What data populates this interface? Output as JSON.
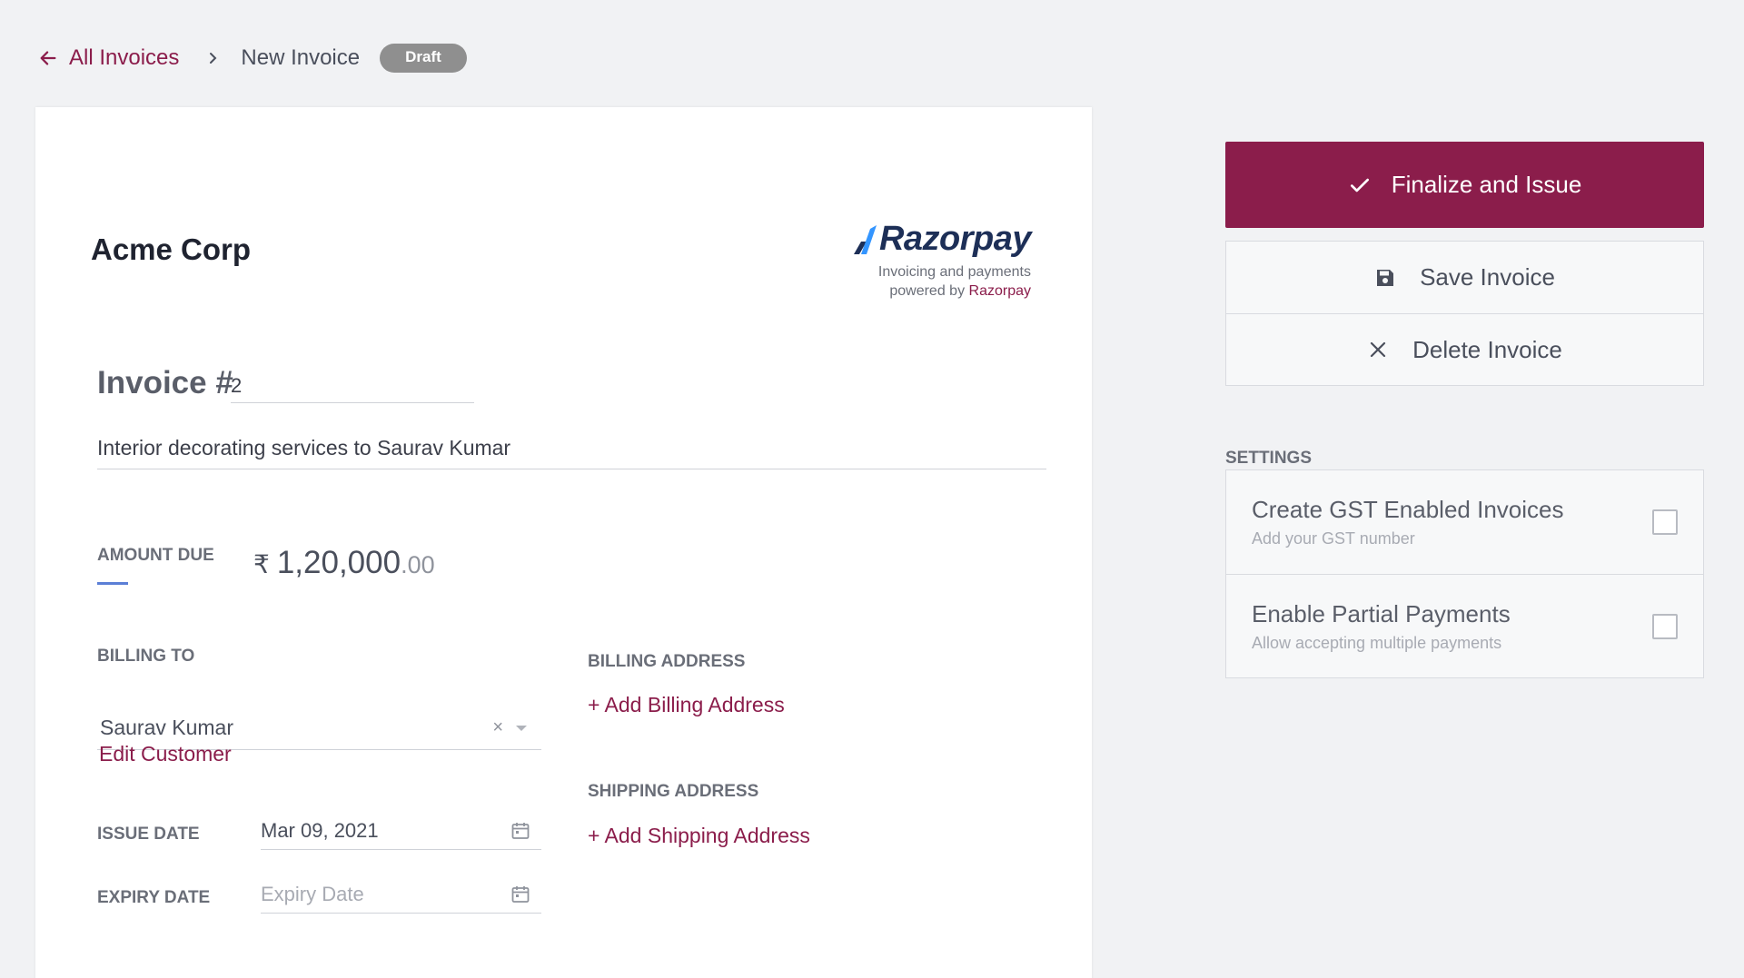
{
  "breadcrumb": {
    "back_label": "All Invoices",
    "current": "New Invoice",
    "status": "Draft"
  },
  "invoice": {
    "company": "Acme Corp",
    "brand": {
      "name": "Razorpay",
      "tagline_line1": "Invoicing and payments",
      "tagline_prefix": "powered by",
      "tagline_brand": "Razorpay"
    },
    "number_label": "Invoice #",
    "number": "2",
    "description": "Interior decorating services to Saurav Kumar",
    "amount_label": "AMOUNT DUE",
    "currency_symbol": "₹",
    "amount_int": "1,20,000",
    "amount_dec": ".00",
    "billing_to_label": "BILLING TO",
    "customer": "Saurav Kumar",
    "clear_glyph": "×",
    "edit_customer": "Edit Customer",
    "issue_date_label": "ISSUE DATE",
    "issue_date": "Mar 09, 2021",
    "expiry_date_label": "EXPIRY DATE",
    "expiry_date_placeholder": "Expiry Date",
    "billing_address_label": "BILLING ADDRESS",
    "add_billing_address": "+ Add Billing Address",
    "shipping_address_label": "SHIPPING ADDRESS",
    "add_shipping_address": "+ Add Shipping Address"
  },
  "actions": {
    "finalize": "Finalize and Issue",
    "save": "Save Invoice",
    "delete": "Delete Invoice"
  },
  "settings": {
    "title": "SETTINGS",
    "items": [
      {
        "title": "Create GST Enabled Invoices",
        "subtitle": "Add your GST number",
        "checked": false
      },
      {
        "title": "Enable Partial Payments",
        "subtitle": "Allow accepting multiple payments",
        "checked": false
      }
    ]
  },
  "colors": {
    "accent": "#8b1d4b",
    "background": "#f1f2f4",
    "brand_navy": "#1d2f57",
    "amount_underline": "#5b7fd6"
  },
  "icons": {
    "back": "arrow-left-icon",
    "separator": "chevron-right-icon",
    "finalize": "check-icon",
    "save": "floppy-disk-icon",
    "delete": "close-icon",
    "date": "calendar-icon"
  }
}
